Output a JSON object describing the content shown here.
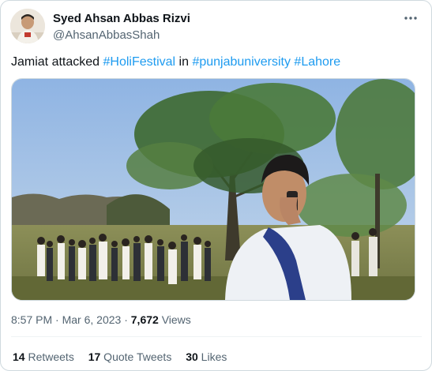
{
  "author": {
    "display_name": "Syed Ahsan Abbas Rizvi",
    "handle": "@AhsanAbbasShah",
    "more_icon": "more-horizontal-icon"
  },
  "tweet": {
    "text_prefix": "Jamiat attacked ",
    "hashtag_holi": "#HoliFestival",
    "text_mid": " in ",
    "hashtag_university": "#punjabuniversity",
    "text_space": " ",
    "hashtag_city": "#Lahore"
  },
  "media": {
    "type": "video-still"
  },
  "meta": {
    "time": "8:57 PM",
    "separator": " · ",
    "date": "Mar 6, 2023",
    "separator2": " · ",
    "views_count": "7,672",
    "views_label": " Views"
  },
  "stats": {
    "retweets_count": "14",
    "retweets_label": " Retweets",
    "quotes_count": "17",
    "quotes_label": " Quote Tweets",
    "likes_count": "30",
    "likes_label": " Likes"
  },
  "colors": {
    "accent": "#1d9bf0",
    "text": "#0f1419",
    "secondary": "#536471",
    "border": "#cfd9de"
  }
}
